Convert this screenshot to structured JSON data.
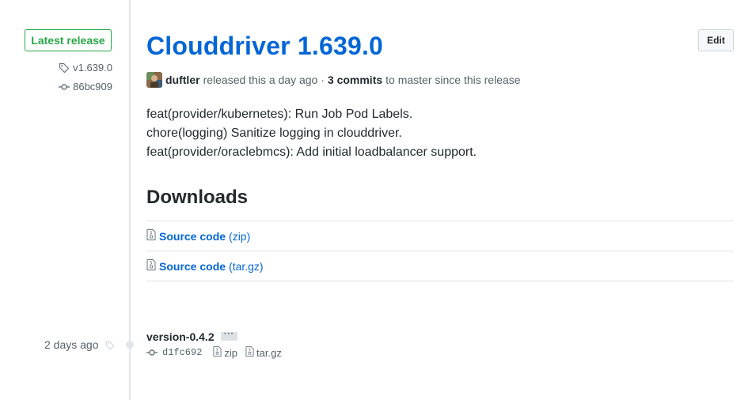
{
  "sidebar": {
    "latest_badge": "Latest release",
    "tag": "v1.639.0",
    "commit": "86bc909"
  },
  "release": {
    "title": "Clouddriver 1.639.0",
    "edit_label": "Edit",
    "author": "duftler",
    "released_text": "released this a day ago ·",
    "commits_count": "3 commits",
    "since_text": "to master since this release",
    "notes": [
      "feat(provider/kubernetes): Run Job Pod Labels.",
      "chore(logging) Sanitize logging in clouddriver.",
      "feat(provider/oraclebmcs): Add initial loadbalancer support."
    ]
  },
  "downloads": {
    "title": "Downloads",
    "items": [
      {
        "name": "Source code",
        "ext": "(zip)"
      },
      {
        "name": "Source code",
        "ext": "(tar.gz)"
      }
    ]
  },
  "previous": {
    "date": "2 days ago",
    "name": "version-0.4.2",
    "more": "···",
    "sha": "d1fc692",
    "zip": "zip",
    "targz": "tar.gz"
  },
  "colors": {
    "link": "#0366d6",
    "badge_green": "#28a745",
    "muted": "#586069"
  }
}
